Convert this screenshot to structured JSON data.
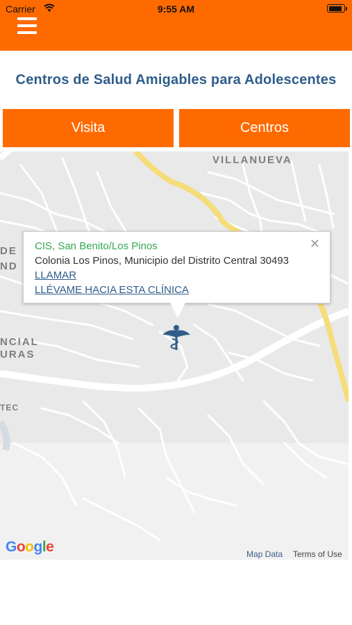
{
  "status_bar": {
    "carrier": "Carrier",
    "time": "9:55 AM",
    "battery_level": 0.9
  },
  "header": {
    "menu_icon": "hamburger-menu-icon",
    "title": "Centros de Salud Amigables para Adolescentes"
  },
  "tabs": [
    {
      "label": "Visita"
    },
    {
      "label": "Centros"
    }
  ],
  "map": {
    "labels": {
      "villanueva": "VILLANUEVA",
      "de": "DE",
      "nd": "ND",
      "ncial": "NCIAL",
      "uras": "URAS",
      "tec": "TEC"
    },
    "google_logo": "Google",
    "map_data": "Map Data",
    "terms": "Terms of Use",
    "marker_icon": "health-caduceus-icon"
  },
  "info_window": {
    "name": "CIS, San Benito/Los Pinos",
    "address": "Colonia Los Pinos, Municipio del Distrito Central 30493",
    "call_link": "LLAMAR",
    "directions_link": "LLÉVAME HACIA ESTA CLÍNICA",
    "close_icon": "close-icon"
  },
  "colors": {
    "brand_orange": "#ff6a00",
    "title_blue": "#2f5d8a",
    "name_green": "#34a853",
    "map_bg": "#e9e9e9"
  }
}
